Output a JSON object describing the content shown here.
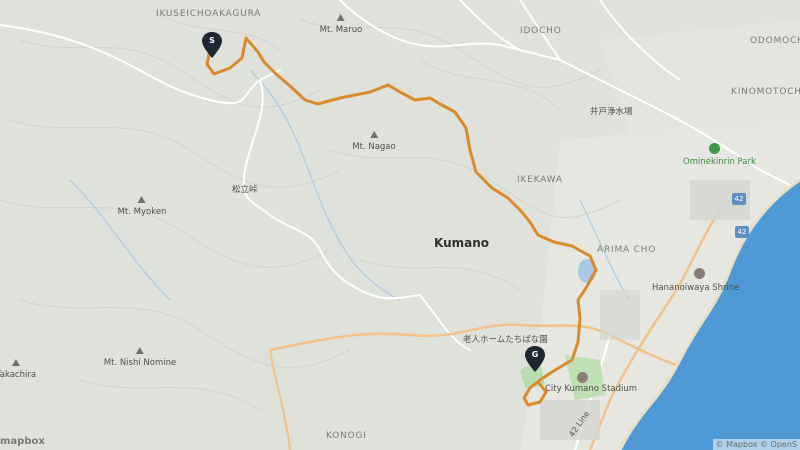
{
  "map": {
    "region_label": "Kumano",
    "place_labels": {
      "ikuseichoakagura": "IKUSEICHOAKAGURA",
      "idocho": "IDOCHO",
      "odomoche": "ODOMOCHE",
      "kinomotocho": "KINOMOTOCHO",
      "ikekawa": "IKEKAWA",
      "arimacho": "ARIMA CHO",
      "konogi": "KONOGI"
    },
    "peaks": {
      "maruo": "Mt. Maruo",
      "nagao": "Mt. Nagao",
      "myoken": "Mt. Myoken",
      "nishi_nomine": "Mt. Nishi Nomine",
      "takachira": "Takachira"
    },
    "pois": {
      "ido_water": "井戸浄水場",
      "matsutoge": "松立峠",
      "ominekinrin_park": "Ominekinrin Park",
      "hananoiwaya_shrine": "Hananoiwaya Shrine",
      "nursing_home": "老人ホームたちばな園",
      "city_stadium": "City Kumano Stadium"
    },
    "roads": {
      "route_42": "42",
      "line_label": "42 Line"
    },
    "markers": {
      "start": "S",
      "goal": "G"
    },
    "colors": {
      "route": "#d98b2b",
      "sea": "#4f9ad6",
      "terrain": "#dfe1db",
      "road_white": "#ffffff",
      "road_major": "#f2c28a"
    },
    "attribution": "© Mapbox © OpenS",
    "logo": "mapbox"
  }
}
